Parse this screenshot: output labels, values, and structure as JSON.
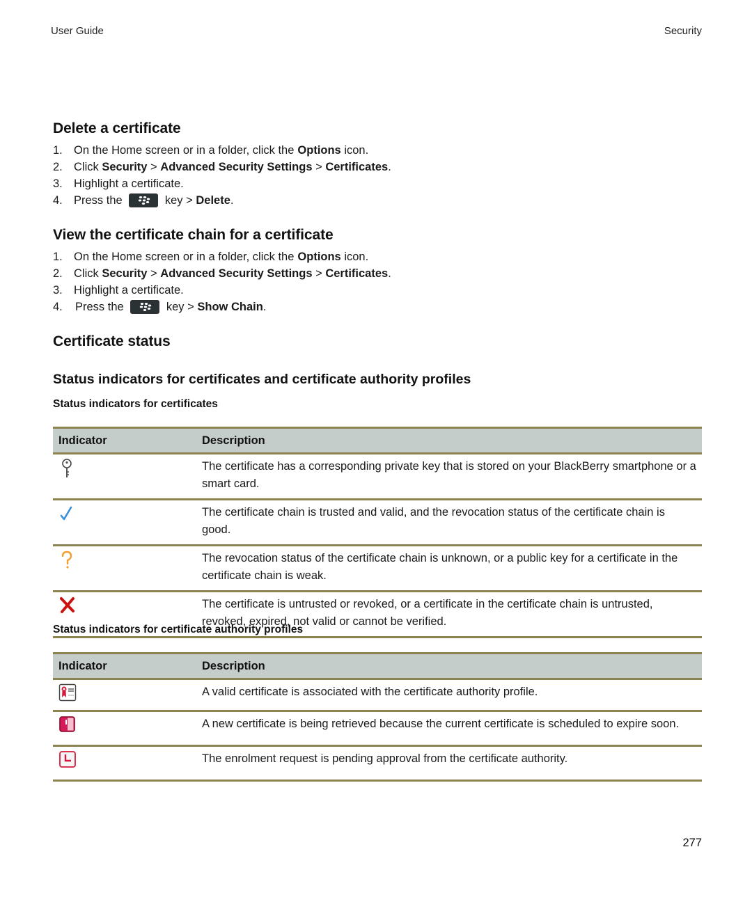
{
  "header": {
    "left": "User Guide",
    "right": "Security"
  },
  "sections": {
    "delete": {
      "title": "Delete a certificate",
      "steps": [
        {
          "num": "1.",
          "pre": "On the Home screen or in a folder, click the ",
          "b1": "Options",
          "post": " icon."
        },
        {
          "num": "2.",
          "pre": "Click ",
          "b1": "Security",
          "sep1": " > ",
          "b2": "Advanced Security Settings",
          "sep2": " > ",
          "b3": "Certificates",
          "post": "."
        },
        {
          "num": "3.",
          "text": "Highlight a certificate."
        },
        {
          "num": "4.",
          "pre": "Press the ",
          "key_icon": "blackberry-menu-key-icon",
          "mid": " key > ",
          "b1": "Delete",
          "post": "."
        }
      ]
    },
    "chain": {
      "title": "View the certificate chain for a certificate",
      "steps": [
        {
          "num": "1.",
          "pre": "On the Home screen or in a folder, click the ",
          "b1": "Options",
          "post": " icon."
        },
        {
          "num": "2.",
          "pre": "Click ",
          "b1": "Security",
          "sep1": " > ",
          "b2": "Advanced Security Settings",
          "sep2": " > ",
          "b3": "Certificates",
          "post": "."
        },
        {
          "num": "3.",
          "text": "Highlight a certificate."
        },
        {
          "num": "4.",
          "pre": "Press the ",
          "key_icon": "blackberry-menu-key-icon",
          "mid": " key > ",
          "b1": "Show Chain",
          "post": "."
        }
      ]
    },
    "status": {
      "title": "Certificate status",
      "subtitle": "Status indicators for certificates and certificate authority profiles",
      "certs_table": {
        "caption": "Status indicators for certificates",
        "headers": [
          "Indicator",
          "Description"
        ],
        "rows": [
          {
            "icon": "private-key-icon",
            "description": "The certificate has a corresponding private key that is stored on your BlackBerry smartphone or a smart card."
          },
          {
            "icon": "trusted-checkmark-icon",
            "description": "The certificate chain is trusted and valid, and the revocation status of the certificate chain is good."
          },
          {
            "icon": "unknown-question-icon",
            "description": "The revocation status of the certificate chain is unknown, or a public key for a certificate in the certificate chain is weak."
          },
          {
            "icon": "untrusted-x-icon",
            "description": "The certificate is untrusted or revoked, or a certificate in the certificate chain is untrusted, revoked, expired, not valid or cannot be verified."
          }
        ]
      },
      "ca_table": {
        "caption": "Status indicators for certificate authority profiles",
        "headers": [
          "Indicator",
          "Description"
        ],
        "rows": [
          {
            "icon": "valid-certificate-icon",
            "description": "A valid certificate is associated with the certificate authority profile."
          },
          {
            "icon": "expiring-certificate-icon",
            "description": "A new certificate is being retrieved because the current certificate is scheduled to expire soon."
          },
          {
            "icon": "pending-enrolment-icon",
            "description": "The enrolment request is pending approval from the certificate authority."
          }
        ]
      }
    }
  },
  "colors": {
    "table_rule": "#8c8352",
    "table_header_bg": "#c5cdcb",
    "check_blue": "#3a8fd9",
    "question_orange": "#f0a030",
    "x_red": "#cc1111",
    "cert_red": "#d41a3a"
  },
  "footer": {
    "page_number": "277"
  }
}
